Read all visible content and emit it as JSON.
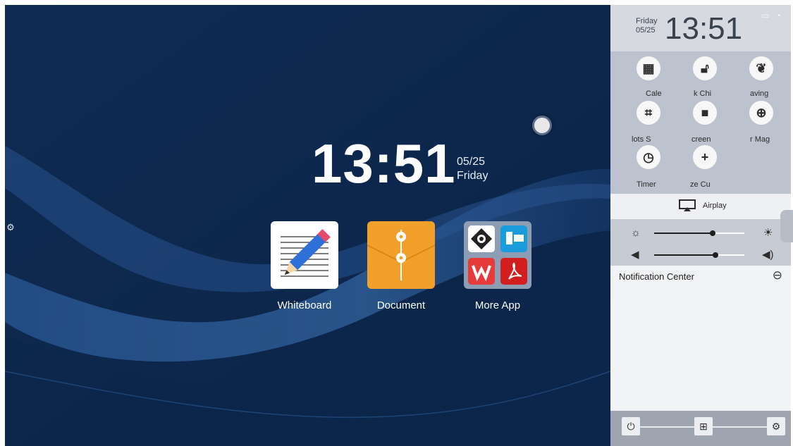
{
  "desktop": {
    "time": "13:51",
    "date": "05/25",
    "weekday": "Friday",
    "apps": [
      {
        "label": "Whiteboard",
        "icon": "pencil-notepad-icon"
      },
      {
        "label": "Document",
        "icon": "envelope-folder-icon"
      },
      {
        "label": "More App",
        "icon": "app-grid-icon"
      }
    ],
    "edge_handle_icon": "gear-icon",
    "floating_button_icon": "assistive-touch-icon"
  },
  "panel": {
    "weekday": "Friday",
    "date": "05/25",
    "time": "13:51",
    "status_icons": [
      "screen-icon",
      "wifi-icon"
    ],
    "quick_actions": [
      {
        "label": "Cale",
        "icon": "calendar-icon"
      },
      {
        "label": "k   Chi",
        "icon": "unlock-icon"
      },
      {
        "label": "aving",
        "icon": "leaf-icon"
      },
      {
        "label": "lots   S",
        "icon": "crop-icon"
      },
      {
        "label": "creen",
        "icon": "video-camera-icon"
      },
      {
        "label": "r   Mag",
        "icon": "zoom-in-icon"
      },
      {
        "label": "Timer",
        "icon": "timer-icon"
      },
      {
        "label": "ze   Cu",
        "icon": "plus-icon"
      }
    ],
    "airplay_label": "Airplay",
    "brightness_level": 0.65,
    "volume_level": 0.68,
    "notification_title": "Notification Center",
    "bottom_buttons": [
      "power-icon",
      "windows-icon",
      "settings-icon"
    ]
  }
}
